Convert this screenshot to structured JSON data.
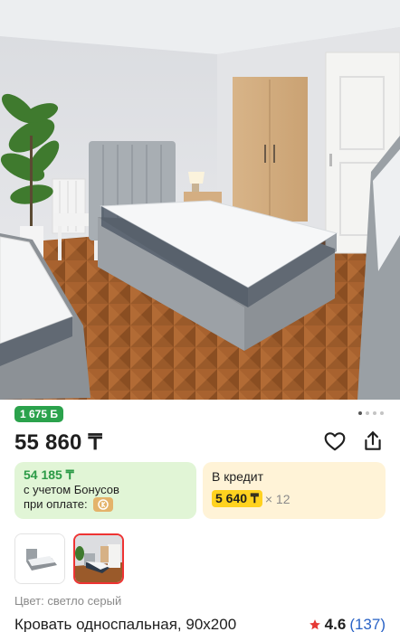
{
  "product": {
    "bonus_badge": "1 675 Б",
    "price": "55 860 ₸",
    "bonus_price": "54 185 ₸",
    "bonus_caption_line1": "с учетом Бонусов",
    "bonus_caption_line2": "при оплате:",
    "credit_label": "В кредит",
    "credit_amount": "5 640 ₸",
    "credit_multiplier": "× 12",
    "color_label": "Цвет: светло серый",
    "title": "Кровать односпальная, 90x200",
    "rating_value": "4.6",
    "rating_count": "(137)"
  },
  "gallery": {
    "dots_total": 4,
    "dots_active": 0
  },
  "icons": {
    "favorite": "heart-icon",
    "share": "share-icon",
    "rating": "star-icon",
    "bonus": "kaspi-coin-icon"
  },
  "colors": {
    "bonus_badge": "#2ba24c",
    "bonus_price": "#2b9a46",
    "bonus_card_bg": "#e1f5d6",
    "credit_card_bg": "#fff3d7",
    "credit_highlight": "#ffd21f",
    "selected_thumb_border": "#ee3333",
    "rating_star": "#e53935",
    "rating_count": "#2a63c6"
  }
}
